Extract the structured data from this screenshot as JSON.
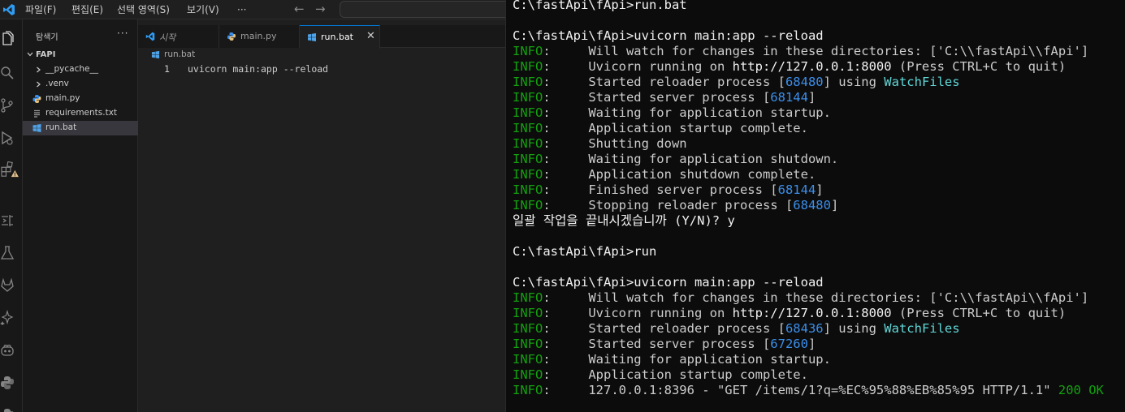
{
  "menubar": {
    "items": [
      "파일(F)",
      "편집(E)",
      "선택 영역(S)",
      "보기(V)"
    ],
    "more": "···",
    "back_icon": "arrow-left-icon",
    "forward_icon": "arrow-right-icon"
  },
  "activity_bar": {
    "icons": [
      "files-icon",
      "search-icon",
      "source-control-icon",
      "run-debug-icon",
      "extensions-warning-icon",
      "remote-explorer-icon",
      "testing-icon",
      "gitlab-icon",
      "ai-sparkle-icon",
      "copilot-icon",
      "python-icon",
      "python-alt-icon"
    ]
  },
  "sidebar": {
    "title": "탐색기",
    "more": "···",
    "folder": "FAPI",
    "items": [
      {
        "label": "__pycache__",
        "type": "folder"
      },
      {
        "label": ".venv",
        "type": "folder"
      },
      {
        "label": "main.py",
        "type": "python"
      },
      {
        "label": "requirements.txt",
        "type": "text"
      },
      {
        "label": "run.bat",
        "type": "bat",
        "selected": true
      }
    ]
  },
  "editor": {
    "tabs": [
      {
        "label": "시작",
        "icon": "vscode-icon",
        "italic": true
      },
      {
        "label": "main.py",
        "icon": "python-icon"
      },
      {
        "label": "run.bat",
        "icon": "windows-icon",
        "active": true,
        "close": "✕"
      }
    ],
    "breadcrumb": "run.bat",
    "line_number": "1",
    "line_text": "uvicorn main:app --reload"
  },
  "terminal": {
    "lines": [
      [
        {
          "t": "C:\\fastApi\\fApi>run.bat",
          "c": "bright"
        }
      ],
      [
        {
          "t": " "
        }
      ],
      [
        {
          "t": "C:\\fastApi\\fApi>uvicorn main:app --reload",
          "c": "bright"
        }
      ],
      [
        {
          "t": "INFO",
          "c": "info"
        },
        {
          "t": ":     Will watch for changes in these directories: ['C:\\\\fastApi\\\\fApi']"
        }
      ],
      [
        {
          "t": "INFO",
          "c": "info"
        },
        {
          "t": ":     Uvicorn running on "
        },
        {
          "t": "http://127.0.0.1:8000",
          "c": "bright"
        },
        {
          "t": " (Press CTRL+C to quit)"
        }
      ],
      [
        {
          "t": "INFO",
          "c": "info"
        },
        {
          "t": ":     Started reloader process ["
        },
        {
          "t": "68480",
          "c": "num"
        },
        {
          "t": "] using "
        },
        {
          "t": "WatchFiles",
          "c": "cyan"
        }
      ],
      [
        {
          "t": "INFO",
          "c": "info"
        },
        {
          "t": ":     Started server process ["
        },
        {
          "t": "68144",
          "c": "num"
        },
        {
          "t": "]"
        }
      ],
      [
        {
          "t": "INFO",
          "c": "info"
        },
        {
          "t": ":     Waiting for application startup."
        }
      ],
      [
        {
          "t": "INFO",
          "c": "info"
        },
        {
          "t": ":     Application startup complete."
        }
      ],
      [
        {
          "t": "INFO",
          "c": "info"
        },
        {
          "t": ":     Shutting down"
        }
      ],
      [
        {
          "t": "INFO",
          "c": "info"
        },
        {
          "t": ":     Waiting for application shutdown."
        }
      ],
      [
        {
          "t": "INFO",
          "c": "info"
        },
        {
          "t": ":     Application shutdown complete."
        }
      ],
      [
        {
          "t": "INFO",
          "c": "info"
        },
        {
          "t": ":     Finished server process ["
        },
        {
          "t": "68144",
          "c": "num"
        },
        {
          "t": "]"
        }
      ],
      [
        {
          "t": "INFO",
          "c": "info"
        },
        {
          "t": ":     Stopping reloader process ["
        },
        {
          "t": "68480",
          "c": "num"
        },
        {
          "t": "]"
        }
      ],
      [
        {
          "t": "일괄 작업을 끝내시겠습니까 (Y/N)? y",
          "c": "bright"
        }
      ],
      [
        {
          "t": " "
        }
      ],
      [
        {
          "t": "C:\\fastApi\\fApi>run",
          "c": "bright"
        }
      ],
      [
        {
          "t": " "
        }
      ],
      [
        {
          "t": "C:\\fastApi\\fApi>uvicorn main:app --reload",
          "c": "bright"
        }
      ],
      [
        {
          "t": "INFO",
          "c": "info"
        },
        {
          "t": ":     Will watch for changes in these directories: ['C:\\\\fastApi\\\\fApi']"
        }
      ],
      [
        {
          "t": "INFO",
          "c": "info"
        },
        {
          "t": ":     Uvicorn running on "
        },
        {
          "t": "http://127.0.0.1:8000",
          "c": "bright"
        },
        {
          "t": " (Press CTRL+C to quit)"
        }
      ],
      [
        {
          "t": "INFO",
          "c": "info"
        },
        {
          "t": ":     Started reloader process ["
        },
        {
          "t": "68436",
          "c": "num"
        },
        {
          "t": "] using "
        },
        {
          "t": "WatchFiles",
          "c": "cyan"
        }
      ],
      [
        {
          "t": "INFO",
          "c": "info"
        },
        {
          "t": ":     Started server process ["
        },
        {
          "t": "67260",
          "c": "num"
        },
        {
          "t": "]"
        }
      ],
      [
        {
          "t": "INFO",
          "c": "info"
        },
        {
          "t": ":     Waiting for application startup."
        }
      ],
      [
        {
          "t": "INFO",
          "c": "info"
        },
        {
          "t": ":     Application startup complete."
        }
      ],
      [
        {
          "t": "INFO",
          "c": "info"
        },
        {
          "t": ":     127.0.0.1:8396 - \"GET /items/1?q=%EC%95%88%EB%85%95 HTTP/1.1\" "
        },
        {
          "t": "200 OK",
          "c": "ok"
        }
      ]
    ]
  },
  "colors": {
    "accent": "#0078d4",
    "info_green": "#13a10e",
    "number_blue": "#3b8eea",
    "cyan": "#61d6d6"
  }
}
